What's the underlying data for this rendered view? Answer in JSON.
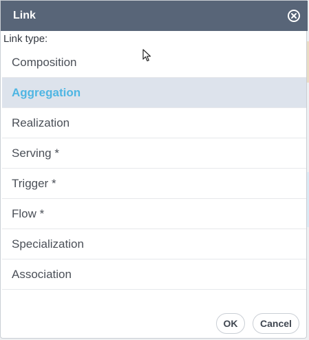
{
  "dialog": {
    "title": "Link",
    "close_icon": "close-circle-icon"
  },
  "form": {
    "link_type_label": "Link type:",
    "options": [
      {
        "label": "Composition",
        "selected": false
      },
      {
        "label": "Aggregation",
        "selected": true
      },
      {
        "label": "Realization",
        "selected": false
      },
      {
        "label": "Serving *",
        "selected": false
      },
      {
        "label": "Trigger *",
        "selected": false
      },
      {
        "label": "Flow *",
        "selected": false
      },
      {
        "label": "Specialization",
        "selected": false
      },
      {
        "label": "Association",
        "selected": false
      }
    ]
  },
  "buttons": {
    "ok_label": "OK",
    "cancel_label": "Cancel"
  },
  "colors": {
    "titlebar": "#586578",
    "selected_bg": "#dde3ec",
    "selected_text": "#4fb6e3"
  }
}
